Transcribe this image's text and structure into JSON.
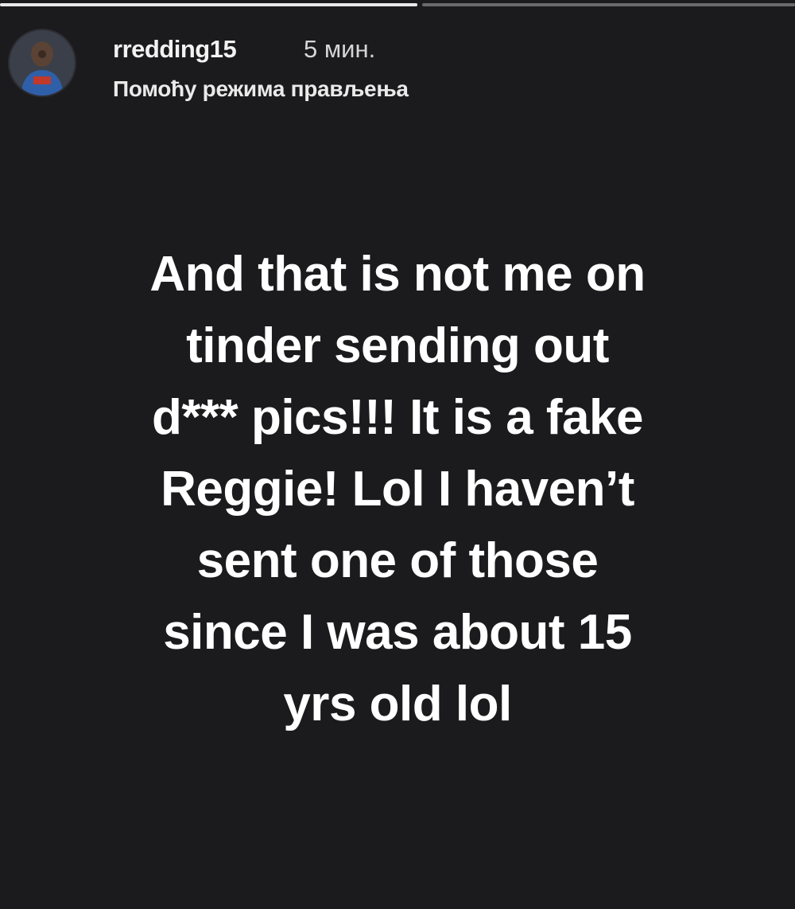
{
  "progress": {
    "segments": [
      {
        "fill": 1.0
      },
      {
        "fill": 0.0
      }
    ]
  },
  "header": {
    "username": "rredding15",
    "time": "5 мин.",
    "subtitle": "Помоћу режима прављења",
    "avatar_icon": "profile-photo"
  },
  "story": {
    "lines": [
      "And that is not me on",
      "tinder sending out",
      "d*** pics!!! It is a fake",
      "Reggie! Lol I haven’t",
      "sent one of those",
      "since I was about 15",
      "yrs old lol"
    ]
  },
  "colors": {
    "background": "#1b1b1d",
    "text": "#ffffff"
  }
}
